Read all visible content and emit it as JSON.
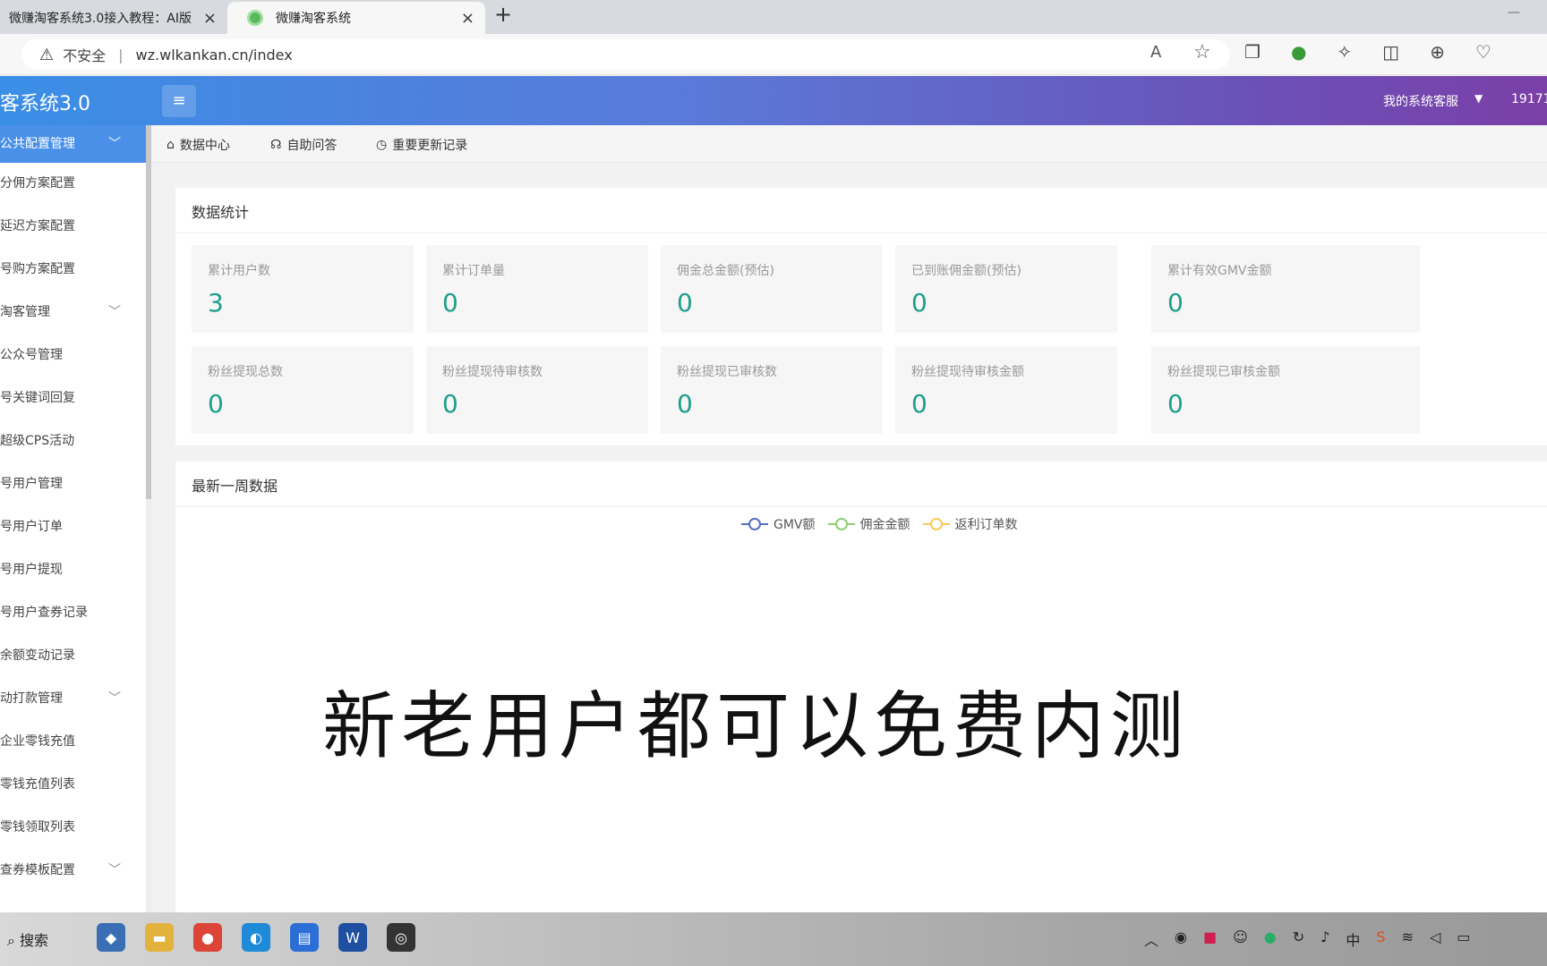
{
  "browser": {
    "tabs": [
      {
        "label": "微赚淘客系统3.0接入教程：AI版"
      },
      {
        "label": "微赚淘客系统"
      }
    ],
    "new_tab": "+",
    "close": "×",
    "security": "不安全",
    "url": "wz.wlkankan.cn/index",
    "read_aloud": "A",
    "favorite": "☆"
  },
  "header": {
    "brand": "客系统3.0",
    "menu_icon": "≡",
    "service": "我的系统客服",
    "user": "19171"
  },
  "sidebar": {
    "items": [
      {
        "label": "公共配置管理",
        "active": true,
        "expand": "﹀"
      },
      {
        "label": "分佣方案配置"
      },
      {
        "label": "延迟方案配置"
      },
      {
        "label": "号购方案配置"
      },
      {
        "label": "淘客管理",
        "expand": "﹀"
      },
      {
        "label": "公众号管理"
      },
      {
        "label": "号关键词回复"
      },
      {
        "label": "超级CPS活动"
      },
      {
        "label": "号用户管理"
      },
      {
        "label": "号用户订单"
      },
      {
        "label": "号用户提现"
      },
      {
        "label": "号用户查券记录"
      },
      {
        "label": "余额变动记录"
      },
      {
        "label": "动打款管理",
        "expand": "﹀"
      },
      {
        "label": "企业零钱充值"
      },
      {
        "label": "零钱充值列表"
      },
      {
        "label": "零钱领取列表"
      },
      {
        "label": "查券模板配置",
        "expand": "﹀"
      }
    ]
  },
  "subnav": [
    {
      "icon": "⌂",
      "label": "数据中心"
    },
    {
      "icon": "☊",
      "label": "自助问答"
    },
    {
      "icon": "◷",
      "label": "重要更新记录"
    }
  ],
  "stats": {
    "title": "数据统计",
    "cards": [
      {
        "label": "累计用户数",
        "value": "3"
      },
      {
        "label": "累计订单量",
        "value": "0"
      },
      {
        "label": "佣金总金额(预估)",
        "value": "0"
      },
      {
        "label": "已到账佣金额(预估)",
        "value": "0"
      },
      {
        "label": "累计有效GMV金额",
        "value": "0"
      },
      {
        "label": "粉丝提现总数",
        "value": "0"
      },
      {
        "label": "粉丝提现待审核数",
        "value": "0"
      },
      {
        "label": "粉丝提现已审核数",
        "value": "0"
      },
      {
        "label": "粉丝提现待审核金额",
        "value": "0"
      },
      {
        "label": "粉丝提现已审核金额",
        "value": "0"
      }
    ]
  },
  "weekly": {
    "title": "最新一周数据",
    "legend": [
      {
        "label": "GMV额",
        "color": "#5470c6"
      },
      {
        "label": "佣金金额",
        "color": "#91cc75"
      },
      {
        "label": "返利订单数",
        "color": "#fac858"
      }
    ]
  },
  "overlay_text": "新老用户都可以免费内测",
  "taskbar": {
    "search": "搜索",
    "tray_ime": "中"
  }
}
